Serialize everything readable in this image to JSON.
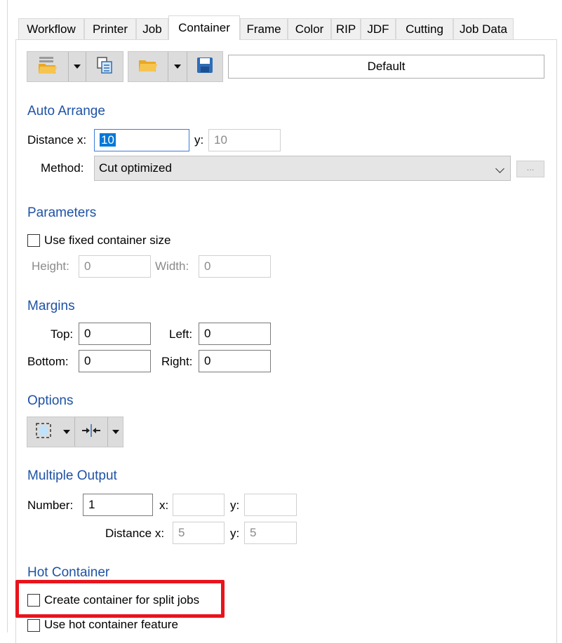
{
  "tabs": [
    {
      "label": "Workflow"
    },
    {
      "label": "Printer"
    },
    {
      "label": "Job"
    },
    {
      "label": "Container"
    },
    {
      "label": "Frame"
    },
    {
      "label": "Color"
    },
    {
      "label": "RIP"
    },
    {
      "label": "JDF"
    },
    {
      "label": "Cutting"
    },
    {
      "label": "Job Data"
    }
  ],
  "active_tab": "Container",
  "toolbar": {
    "preset_name": "Default",
    "icons": [
      "open-folder-icon",
      "copy-pages-icon",
      "open-folder-icon",
      "save-disk-icon"
    ]
  },
  "auto_arrange": {
    "title": "Auto Arrange",
    "distance_x_label": "Distance x:",
    "distance_x_value": "10",
    "y_label": "y:",
    "y_value": "10",
    "method_label": "Method:",
    "method_value": "Cut optimized",
    "more_button": "..."
  },
  "parameters": {
    "title": "Parameters",
    "fixed_size_label": "Use fixed container size",
    "fixed_size_checked": false,
    "height_label": "Height:",
    "height_value": "0",
    "width_label": "Width:",
    "width_value": "0"
  },
  "margins": {
    "title": "Margins",
    "top_label": "Top:",
    "top_value": "0",
    "left_label": "Left:",
    "left_value": "0",
    "bottom_label": "Bottom:",
    "bottom_value": "0",
    "right_label": "Right:",
    "right_value": "0"
  },
  "options": {
    "title": "Options",
    "icons": [
      "selection-frame-icon",
      "compress-arrows-icon"
    ]
  },
  "multiple_output": {
    "title": "Multiple Output",
    "number_label": "Number:",
    "number_value": "1",
    "x_label": "x:",
    "x_value": "",
    "y_label": "y:",
    "y_value": "",
    "distance_x_label": "Distance x:",
    "distance_x_value": "5",
    "distance_y_label": "y:",
    "distance_y_value": "5"
  },
  "hot_container": {
    "title": "Hot Container",
    "split_jobs_label": "Create container for split jobs",
    "split_jobs_checked": false,
    "hot_feature_label": "Use hot container feature",
    "hot_feature_checked": false
  },
  "colors": {
    "section_title": "#1e52a5",
    "highlight": "#e8141c",
    "selection": "#0078d7"
  }
}
